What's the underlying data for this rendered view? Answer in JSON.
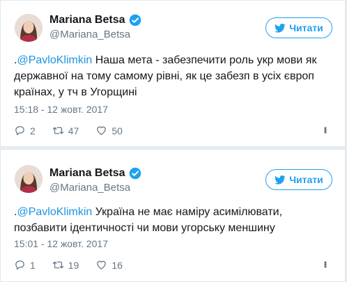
{
  "tweets": [
    {
      "name": "Mariana Betsa",
      "handle": "@Mariana_Betsa",
      "follow_label": "Читати",
      "prefix": ".",
      "mention": "@PavloKlimkin",
      "text": " Наша мета - забезпечити роль укр мови як державної на тому самому рівні, як це забезп в усіх європ країнах, у тч в Угорщині",
      "timestamp": "15:18 - 12 жовт. 2017",
      "replies": "2",
      "retweets": "47",
      "likes": "50"
    },
    {
      "name": "Mariana Betsa",
      "handle": "@Mariana_Betsa",
      "follow_label": "Читати",
      "prefix": ".",
      "mention": "@PavloKlimkin",
      "text": " Україна не має наміру асимілювати, позбавити ідентичності чи мови угорську меншину",
      "timestamp": "15:01 - 12 жовт. 2017",
      "replies": "1",
      "retweets": "19",
      "likes": "16"
    }
  ],
  "colors": {
    "accent": "#1da1f2",
    "link": "#1b95e0",
    "muted": "#657786",
    "background": "#e6ecf0"
  }
}
